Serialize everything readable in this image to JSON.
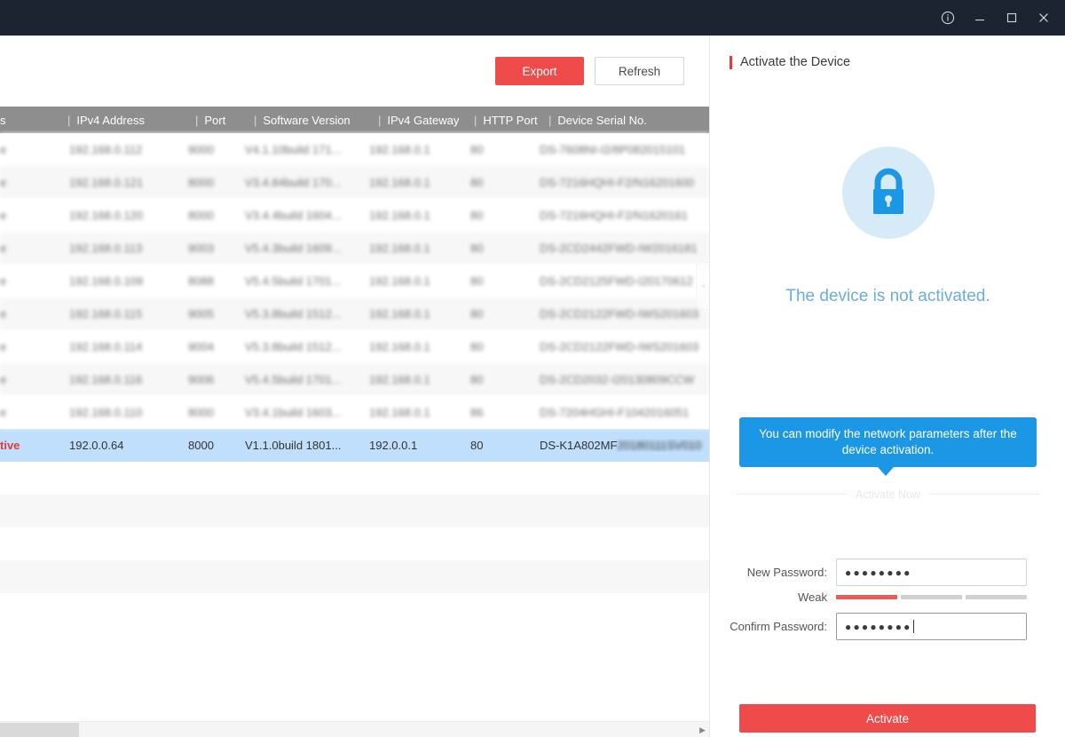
{
  "titlebar": {
    "icons": [
      {
        "name": "info-icon",
        "label": "Info"
      },
      {
        "name": "minimize-icon",
        "label": "Minimize"
      },
      {
        "name": "maximize-icon",
        "label": "Maximize"
      },
      {
        "name": "close-icon",
        "label": "Close"
      }
    ]
  },
  "toolbar": {
    "export_label": "Export",
    "refresh_label": "Refresh"
  },
  "table": {
    "columns": [
      {
        "key": "status",
        "label": "s"
      },
      {
        "key": "ipv4",
        "label": "IPv4 Address"
      },
      {
        "key": "port",
        "label": "Port"
      },
      {
        "key": "software",
        "label": "Software Version"
      },
      {
        "key": "gateway",
        "label": "IPv4 Gateway"
      },
      {
        "key": "http",
        "label": "HTTP Port"
      },
      {
        "key": "serial",
        "label": "Device Serial No."
      }
    ],
    "separator": "|",
    "rows": [
      {
        "status": "e",
        "ipv4": "192.168.0.112",
        "port": "9000",
        "software": "V4.1.10build 171...",
        "gateway": "192.168.0.1",
        "http": "80",
        "serial": "DS-7608NI-I2/8P082015101",
        "blurred": true,
        "selected": false
      },
      {
        "status": "e",
        "ipv4": "192.168.0.121",
        "port": "8000",
        "software": "V3.4.84build 170...",
        "gateway": "192.168.0.1",
        "http": "80",
        "serial": "DS-7216HQHI-F2/N16201600",
        "blurred": true,
        "selected": false
      },
      {
        "status": "e",
        "ipv4": "192.168.0.120",
        "port": "8000",
        "software": "V3.4.4build 1604...",
        "gateway": "192.168.0.1",
        "http": "80",
        "serial": "DS-7216HQHI-F2/N1620161",
        "blurred": true,
        "selected": false
      },
      {
        "status": "e",
        "ipv4": "192.168.0.113",
        "port": "9003",
        "software": "V5.4.3build 1609...",
        "gateway": "192.168.0.1",
        "http": "80",
        "serial": "DS-2CD2442FWD-IW2016181",
        "blurred": true,
        "selected": false
      },
      {
        "status": "e",
        "ipv4": "192.168.0.109",
        "port": "8088",
        "software": "V5.4.5build 1701...",
        "gateway": "192.168.0.1",
        "http": "80",
        "serial": "DS-2CD2125FWD-I20170612",
        "blurred": true,
        "selected": false
      },
      {
        "status": "e",
        "ipv4": "192.168.0.115",
        "port": "9005",
        "software": "V5.3.8build 1512...",
        "gateway": "192.168.0.1",
        "http": "80",
        "serial": "DS-2CD2122FWD-IWS201603",
        "blurred": true,
        "selected": false
      },
      {
        "status": "e",
        "ipv4": "192.168.0.114",
        "port": "9004",
        "software": "V5.3.8build 1512...",
        "gateway": "192.168.0.1",
        "http": "80",
        "serial": "DS-2CD2122FWD-IWS201603",
        "blurred": true,
        "selected": false
      },
      {
        "status": "e",
        "ipv4": "192.168.0.116",
        "port": "9006",
        "software": "V5.4.5build 1701...",
        "gateway": "192.168.0.1",
        "http": "80",
        "serial": "DS-2CD2032-I20130809CCW",
        "blurred": true,
        "selected": false
      },
      {
        "status": "e",
        "ipv4": "192.168.0.110",
        "port": "8000",
        "software": "V3.4.1build 1603...",
        "gateway": "192.168.0.1",
        "http": "86",
        "serial": "DS-7204HGHI-F1042016051",
        "blurred": true,
        "selected": false
      },
      {
        "status": "tive",
        "ipv4": "192.0.0.64",
        "port": "8000",
        "software": "V1.1.0build 1801...",
        "gateway": "192.0.0.1",
        "http": "80",
        "serial": "DS-K1A802MF",
        "serial_blurred_suffix": "20180111SV010",
        "blurred": false,
        "selected": true
      }
    ],
    "empty_row_count": 5,
    "collapse_tab_icon": "chevron-left-icon"
  },
  "scrollbar": {
    "right_arrow_icon": "triangle-right-icon"
  },
  "panel": {
    "title": "Activate the Device",
    "lock_icon": "lock-icon",
    "status_text": "The device is not activated.",
    "tooltip_text": "You can modify the network parameters after the device activation.",
    "divider_label": "Activate Now",
    "new_password_label": "New Password:",
    "new_password_value": "●●●●●●●●",
    "strength_label": "Weak",
    "strength_segments_filled": 1,
    "strength_segments_total": 3,
    "confirm_password_label": "Confirm Password:",
    "confirm_password_value": "●●●●●●●●",
    "activate_label": "Activate"
  },
  "colors": {
    "titlebar_bg": "#1c2331",
    "accent_red": "#f04b4b",
    "accent_blue": "#1c97e6",
    "header_gray": "#8e8e8e",
    "selected_row": "#bfdffc",
    "status_blue": "#6aaee0",
    "strength_weak": "#ec5b56"
  }
}
